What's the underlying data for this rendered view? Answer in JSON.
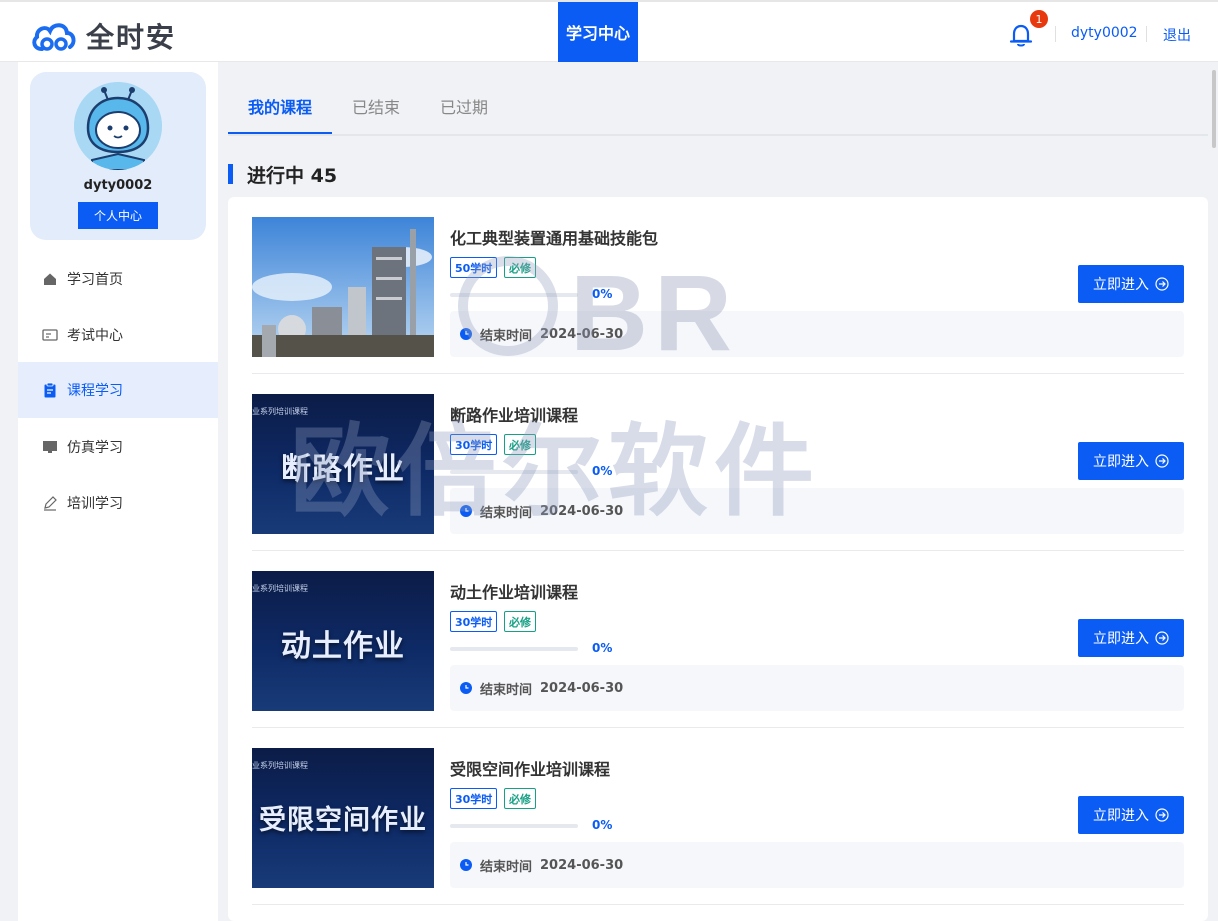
{
  "header": {
    "logo_text": "全时安",
    "nav_active": "学习中心",
    "notification_count": "1",
    "username": "dyty0002",
    "logout": "退出"
  },
  "sidebar": {
    "profile_name": "dyty0002",
    "profile_button": "个人中心",
    "items": [
      {
        "label": "学习首页",
        "icon": "home-icon"
      },
      {
        "label": "考试中心",
        "icon": "id-card-icon"
      },
      {
        "label": "课程学习",
        "icon": "clipboard-icon",
        "active": true
      },
      {
        "label": "仿真学习",
        "icon": "monitor-icon"
      },
      {
        "label": "培训学习",
        "icon": "pen-icon"
      }
    ]
  },
  "tabs": [
    "我的课程",
    "已结束",
    "已过期"
  ],
  "section": {
    "title": "进行中 45"
  },
  "courses": [
    {
      "title": "化工典型装置通用基础技能包",
      "hours": "50学时",
      "required": "必修",
      "progress": "0%",
      "progress_value": 0,
      "end_label": "结束时间",
      "end_date": "2024-06-30",
      "button": "立即进入",
      "thumb_small": "",
      "thumb_big": ""
    },
    {
      "title": "断路作业培训课程",
      "hours": "30学时",
      "required": "必修",
      "progress": "0%",
      "progress_value": 0,
      "end_label": "结束时间",
      "end_date": "2024-06-30",
      "button": "立即进入",
      "thumb_small": "业系列培训课程",
      "thumb_big": "断路作业"
    },
    {
      "title": "动土作业培训课程",
      "hours": "30学时",
      "required": "必修",
      "progress": "0%",
      "progress_value": 0,
      "end_label": "结束时间",
      "end_date": "2024-06-30",
      "button": "立即进入",
      "thumb_small": "业系列培训课程",
      "thumb_big": "动土作业"
    },
    {
      "title": "受限空间作业培训课程",
      "hours": "30学时",
      "required": "必修",
      "progress": "0%",
      "progress_value": 0,
      "end_label": "结束时间",
      "end_date": "2024-06-30",
      "button": "立即进入",
      "thumb_small": "业系列培训课程",
      "thumb_big": "受限空间作业"
    }
  ],
  "watermark": {
    "latin": "BR",
    "chinese": "欧倍尔软件"
  },
  "colors": {
    "primary": "#0a5cf5",
    "required_tag": "#16a085",
    "badge": "#e8380d"
  }
}
